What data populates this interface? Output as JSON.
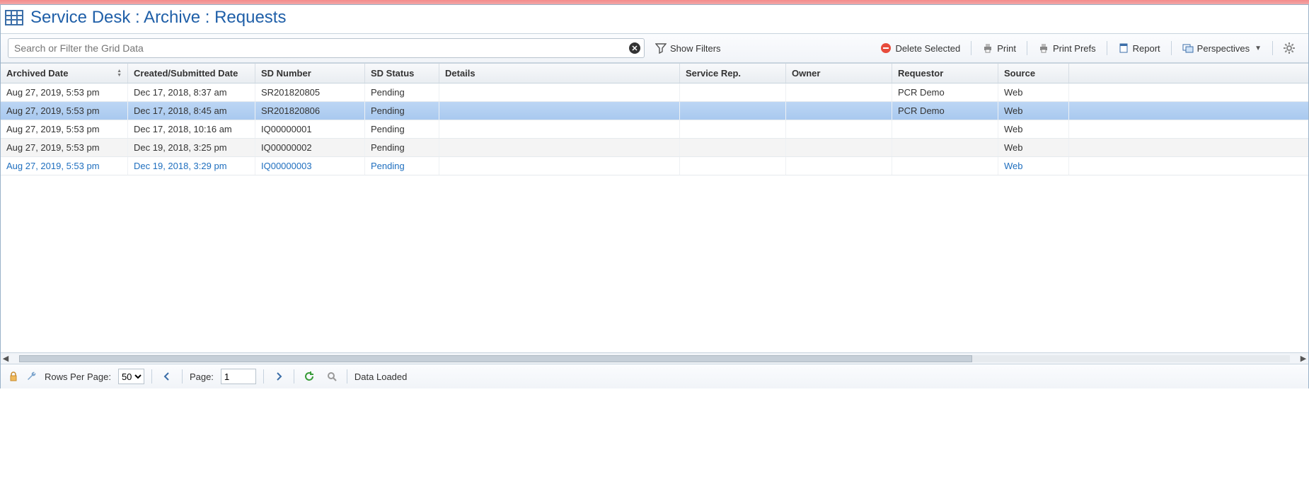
{
  "header": {
    "title": "Service Desk : Archive : Requests"
  },
  "toolbar": {
    "search_placeholder": "Search or Filter the Grid Data",
    "show_filters": "Show Filters",
    "delete_selected": "Delete Selected",
    "print": "Print",
    "print_prefs": "Print Prefs",
    "report": "Report",
    "perspectives": "Perspectives"
  },
  "grid": {
    "columns": [
      "Archived Date",
      "Created/Submitted Date",
      "SD Number",
      "SD Status",
      "Details",
      "Service Rep.",
      "Owner",
      "Requestor",
      "Source"
    ],
    "rows": [
      {
        "archived": "Aug 27, 2019, 5:53 pm",
        "created": "Dec 17, 2018, 8:37 am",
        "sd": "SR201820805",
        "status": "Pending",
        "details": "",
        "rep": "",
        "owner": "",
        "requestor": "PCR Demo",
        "source": "Web",
        "selected": false,
        "link": false
      },
      {
        "archived": "Aug 27, 2019, 5:53 pm",
        "created": "Dec 17, 2018, 8:45 am",
        "sd": "SR201820806",
        "status": "Pending",
        "details": "",
        "rep": "",
        "owner": "",
        "requestor": "PCR Demo",
        "source": "Web",
        "selected": true,
        "link": false
      },
      {
        "archived": "Aug 27, 2019, 5:53 pm",
        "created": "Dec 17, 2018, 10:16 am",
        "sd": "IQ00000001",
        "status": "Pending",
        "details": "",
        "rep": "",
        "owner": "",
        "requestor": "",
        "source": "Web",
        "selected": false,
        "link": false
      },
      {
        "archived": "Aug 27, 2019, 5:53 pm",
        "created": "Dec 19, 2018, 3:25 pm",
        "sd": "IQ00000002",
        "status": "Pending",
        "details": "",
        "rep": "",
        "owner": "",
        "requestor": "",
        "source": "Web",
        "selected": false,
        "link": false
      },
      {
        "archived": "Aug 27, 2019, 5:53 pm",
        "created": "Dec 19, 2018, 3:29 pm",
        "sd": "IQ00000003",
        "status": "Pending",
        "details": "",
        "rep": "",
        "owner": "",
        "requestor": "",
        "source": "Web",
        "selected": false,
        "link": true
      }
    ]
  },
  "footer": {
    "rows_per_page_label": "Rows Per Page:",
    "rows_per_page_value": "50",
    "page_label": "Page:",
    "page_value": "1",
    "status": "Data Loaded"
  }
}
